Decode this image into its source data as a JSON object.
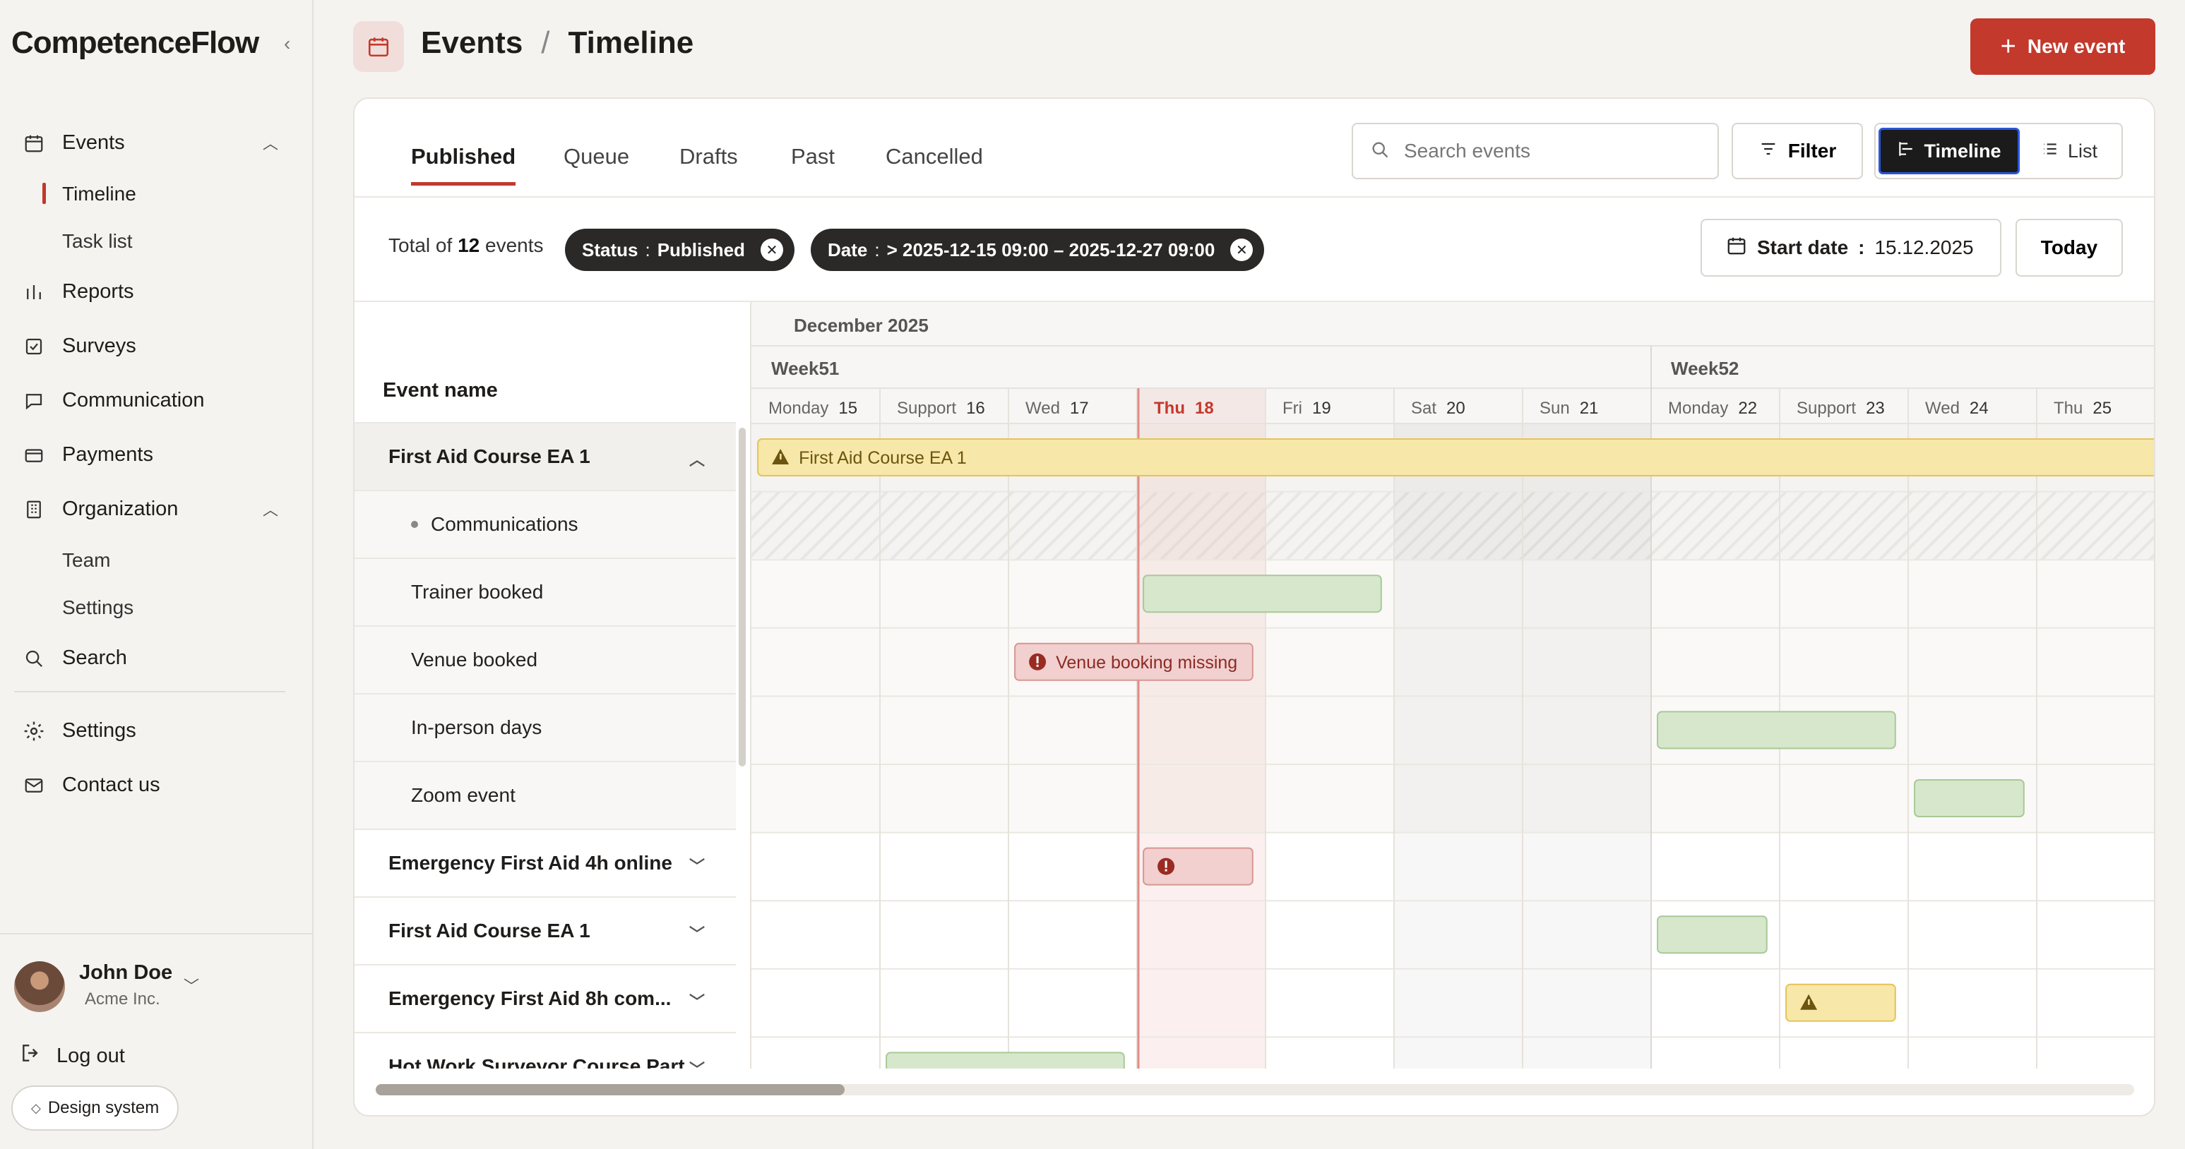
{
  "app": {
    "brand": "CompetenceFlow"
  },
  "sidebar": {
    "events": "Events",
    "timeline": "Timeline",
    "task_list": "Task list",
    "reports": "Reports",
    "surveys": "Surveys",
    "communication": "Communication",
    "payments": "Payments",
    "organization": "Organization",
    "team": "Team",
    "settings_sub": "Settings",
    "search": "Search",
    "settings": "Settings",
    "contact": "Contact us",
    "user_name": "John Doe",
    "user_org": "Acme Inc.",
    "logout": "Log out",
    "design_system": "Design system"
  },
  "header": {
    "section": "Events",
    "separator": "/",
    "page": "Timeline",
    "new_event": "New event"
  },
  "tabs": [
    "Published",
    "Queue",
    "Drafts",
    "Past",
    "Cancelled"
  ],
  "search": {
    "placeholder": "Search events"
  },
  "toolbar": {
    "filter": "Filter",
    "timeline": "Timeline",
    "list": "List"
  },
  "filters": {
    "total_prefix": "Total of",
    "total_count": "12",
    "total_suffix": "events",
    "status_key": "Status",
    "status_value": "Published",
    "date_key": "Date",
    "date_value": "> 2025-12-15 09:00 – 2025-12-27 09:00",
    "start_label": "Start date",
    "start_value": "15.12.2025",
    "today": "Today"
  },
  "timeline": {
    "month": "December 2025",
    "weeks": [
      "Week51",
      "Week52"
    ],
    "days": [
      {
        "name": "Monday",
        "num": "15"
      },
      {
        "name": "Support",
        "num": "16"
      },
      {
        "name": "Wed",
        "num": "17"
      },
      {
        "name": "Thu",
        "num": "18",
        "today": true
      },
      {
        "name": "Fri",
        "num": "19"
      },
      {
        "name": "Sat",
        "num": "20",
        "weekend": true
      },
      {
        "name": "Sun",
        "num": "21",
        "weekend": true
      },
      {
        "name": "Monday",
        "num": "22"
      },
      {
        "name": "Support",
        "num": "23"
      },
      {
        "name": "Wed",
        "num": "24"
      },
      {
        "name": "Thu",
        "num": "25"
      }
    ],
    "event_name_header": "Event name",
    "rows": [
      {
        "label": "First Aid Course EA 1",
        "type": "parent",
        "expanded": true
      },
      {
        "label": "Communications",
        "type": "child",
        "dot": true,
        "hatched": true
      },
      {
        "label": "Trainer booked",
        "type": "child"
      },
      {
        "label": "Venue booked",
        "type": "child"
      },
      {
        "label": "In-person days",
        "type": "child"
      },
      {
        "label": "Zoom event",
        "type": "child"
      },
      {
        "label": "Emergency First Aid 4h online",
        "type": "parent"
      },
      {
        "label": "First Aid Course EA 1",
        "type": "parent"
      },
      {
        "label": "Emergency First Aid 8h com...",
        "type": "parent"
      },
      {
        "label": "Hot Work Surveyor Course Part...",
        "type": "parent"
      }
    ],
    "bars": [
      {
        "row": 0,
        "start": 0.05,
        "end": 11.2,
        "kind": "warning",
        "label": "First Aid Course EA 1",
        "icon": "warning-icon"
      },
      {
        "row": 2,
        "start": 3.05,
        "end": 4.9,
        "kind": "success",
        "label": ""
      },
      {
        "row": 3,
        "start": 2.05,
        "end": 3.9,
        "kind": "error",
        "label": "Venue booking missing",
        "icon": "alert-icon"
      },
      {
        "row": 4,
        "start": 7.05,
        "end": 8.9,
        "kind": "success",
        "label": ""
      },
      {
        "row": 5,
        "start": 9.05,
        "end": 9.9,
        "kind": "success",
        "label": ""
      },
      {
        "row": 6,
        "start": 3.05,
        "end": 3.9,
        "kind": "error",
        "label": "",
        "icon": "alert-icon"
      },
      {
        "row": 7,
        "start": 7.05,
        "end": 7.9,
        "kind": "success",
        "label": ""
      },
      {
        "row": 8,
        "start": 8.05,
        "end": 8.9,
        "kind": "warning",
        "label": "",
        "icon": "warning-icon"
      },
      {
        "row": 9,
        "start": 1.05,
        "end": 2.9,
        "kind": "success",
        "label": ""
      }
    ]
  },
  "colors": {
    "accent": "#c3392c",
    "success_fill": "#d6e7cc",
    "success_border": "#a9c997",
    "warning_fill": "#f7e7a8",
    "warning_border": "#e3c45a",
    "error_fill": "#f1d0cf",
    "error_border": "#d89693",
    "today_line": "#e38b86"
  }
}
